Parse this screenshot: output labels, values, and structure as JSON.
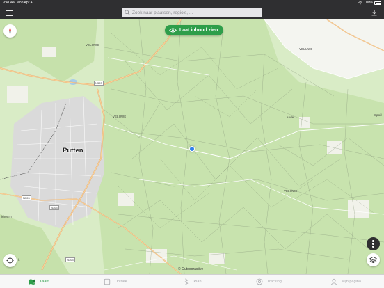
{
  "status": {
    "time": "9:41 AM",
    "date": "Mon Apr 4",
    "battery": "100%"
  },
  "search": {
    "placeholder": "Zoek naar plaatsen, regio's, ..."
  },
  "map": {
    "content_button": "Laat inhoud zien",
    "attribution": "© Outdooractive",
    "places": {
      "main": "Putten",
      "spoil": "Spoil",
      "ende": "ende",
      "ikhoorn": "ikhoorn",
      "lt": "lt"
    },
    "roads": [
      "N303",
      "N303",
      "N303",
      "N303"
    ],
    "terrain_labels": [
      "VELUWE",
      "VELUWE",
      "VELUWE",
      "VELUWE"
    ]
  },
  "tabs": [
    {
      "label": "Kaart",
      "icon": "map-icon",
      "active": true
    },
    {
      "label": "Ontdek",
      "icon": "discover-icon",
      "active": false
    },
    {
      "label": "Plan",
      "icon": "plan-icon",
      "active": false
    },
    {
      "label": "Tracking",
      "icon": "tracking-icon",
      "active": false
    },
    {
      "label": "Mijn pagina",
      "icon": "profile-icon",
      "active": false
    }
  ],
  "colors": {
    "accent": "#2e9e4a",
    "map_forest": "#c9e3b0",
    "location": "#2f80ed",
    "bar": "#2f2f31"
  }
}
